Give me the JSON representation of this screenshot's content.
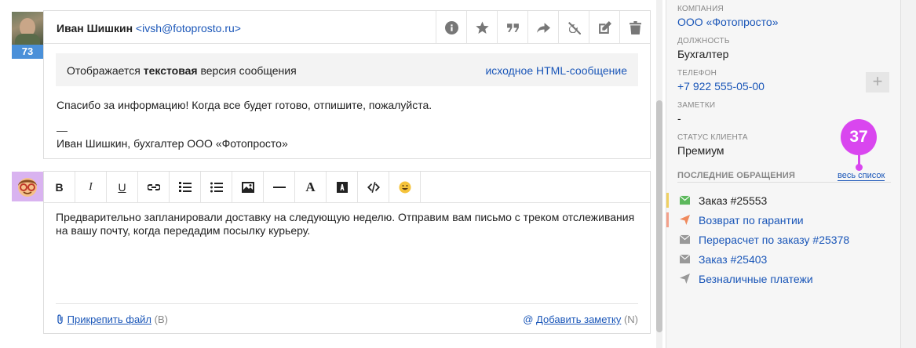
{
  "message": {
    "sender_name": "Иван Шишкин",
    "sender_email": "<ivsh@fotoprosto.ru>",
    "score": "73",
    "notice_prefix": "Отображается ",
    "notice_bold": "текстовая",
    "notice_suffix": " версия сообщения",
    "notice_link": "исходное HTML-сообщение",
    "body": "Спасибо за информацию! Когда все будет готово, отпишите, пожалуйста.",
    "sig_dash": "—",
    "signature": "Иван Шишкин, бухгалтер ООО «Фотопросто»",
    "actions": [
      "info-icon",
      "star-icon",
      "quote-icon",
      "forward-icon",
      "unlink-icon",
      "edit-icon",
      "trash-icon"
    ]
  },
  "editor": {
    "toolbar": {
      "bold": "B",
      "italic": "I",
      "underline": "U",
      "font_color": "A"
    },
    "text": "Предварительно запланировали доставку на следующую неделю. Отправим вам письмо с треком отслеживания на вашу почту, когда передадим посылку курьеру.",
    "attach_label": "Прикрепить файл",
    "attach_hint": "(B)",
    "note_label": "Добавить заметку",
    "note_hint": "(N)"
  },
  "client": {
    "company_label": "КОМПАНИЯ",
    "company": "ООО «Фотопросто»",
    "position_label": "ДОЛЖНОСТЬ",
    "position": "Бухгалтер",
    "phone_label": "ТЕЛЕФОН",
    "phone": "+7 922 555-05-00",
    "notes_label": "ЗАМЕТКИ",
    "notes": "-",
    "status_label": "СТАТУС КЛИЕНТА",
    "status": "Премиум",
    "plus": "+"
  },
  "recent": {
    "heading": "ПОСЛЕДНИЕ ОБРАЩЕНИЯ",
    "all_link": "весь список",
    "badge": "37",
    "items": [
      {
        "label": "Заказ #25553",
        "icon": "envelope-icon",
        "icon_color": "#5cb85c",
        "bar_color": "#f0d060"
      },
      {
        "label": "Возврат по гарантии",
        "icon": "paper-plane-icon",
        "icon_color": "#f08a5d",
        "bar_color": "#f4a08a"
      },
      {
        "label": "Перерасчет по заказу #25378",
        "icon": "envelope-icon",
        "icon_color": "#999999",
        "bar_color": ""
      },
      {
        "label": "Заказ #25403",
        "icon": "envelope-icon",
        "icon_color": "#999999",
        "bar_color": ""
      },
      {
        "label": "Безналичные платежи",
        "icon": "paper-plane-icon",
        "icon_color": "#999999",
        "bar_color": ""
      }
    ]
  }
}
